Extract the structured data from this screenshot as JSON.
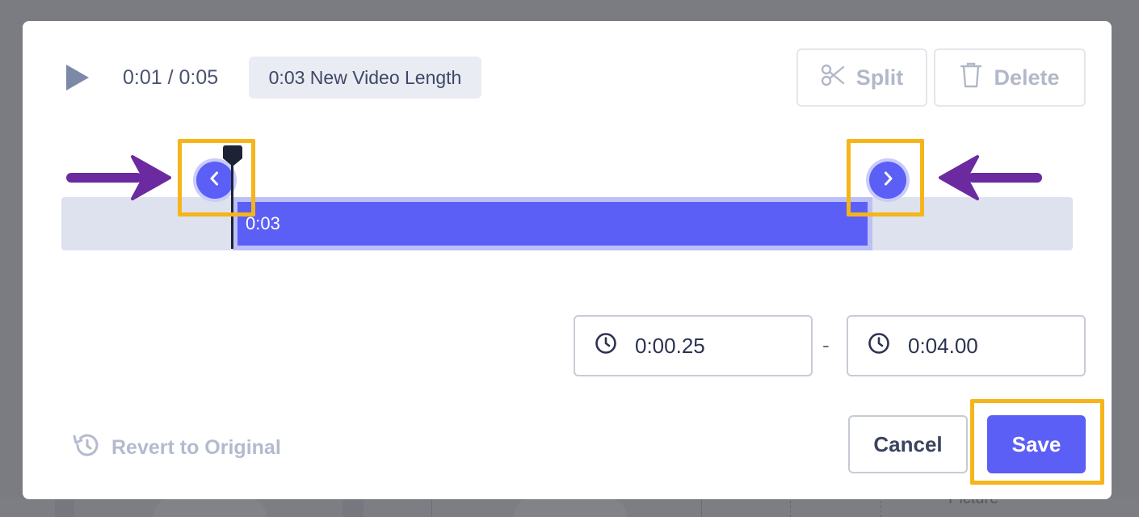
{
  "player": {
    "play_icon": "play-icon",
    "time_display": "0:01 / 0:05",
    "new_length_label": "0:03 New Video Length"
  },
  "toolbar": {
    "split_label": "Split",
    "split_icon": "scissors-icon",
    "delete_label": "Delete",
    "delete_icon": "trash-icon"
  },
  "timeline": {
    "selection_label": "0:03",
    "left_handle_icon": "chevron-left-icon",
    "right_handle_icon": "chevron-right-icon",
    "playhead_icon": "playhead-marker"
  },
  "trim": {
    "start_value": "0:00.25",
    "separator": "-",
    "end_value": "0:04.00",
    "field_icon": "clock-icon"
  },
  "footer": {
    "revert_label": "Revert to Original",
    "revert_icon": "history-icon",
    "cancel_label": "Cancel",
    "save_label": "Save"
  },
  "background": {
    "partial_text": "Picture"
  },
  "colors": {
    "accent": "#5b5ff5",
    "highlight": "#f5b51a",
    "annotation_arrow": "#6b2aa0",
    "track": "#dde2ee"
  }
}
